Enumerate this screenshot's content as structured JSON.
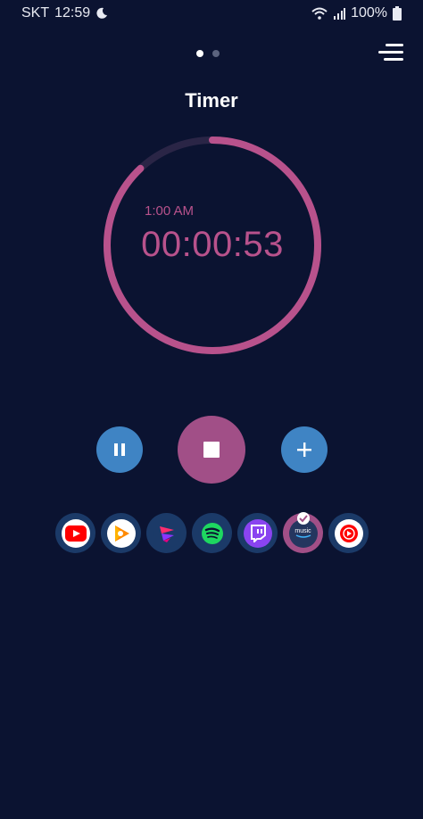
{
  "status_bar": {
    "carrier": "SKT",
    "time": "12:59",
    "battery": "100%",
    "icons": [
      "moon-icon",
      "wifi-icon",
      "signal-icon",
      "battery-icon"
    ]
  },
  "pager": {
    "pages": 2,
    "current": 1
  },
  "header": {
    "title": "Timer",
    "menu_icon": "menu-icon"
  },
  "timer": {
    "end_time": "1:00 AM",
    "remaining": "00:00:53",
    "progress_remaining": 0.88,
    "ring_color": "#b8528c",
    "track_color": "#2a2546"
  },
  "controls": {
    "pause_icon": "pause-icon",
    "stop_icon": "stop-icon",
    "add_icon": "plus-icon",
    "button_color": "#3f84c4",
    "stop_color": "#a14f87"
  },
  "apps": [
    {
      "name": "youtube",
      "icon": "youtube-icon"
    },
    {
      "name": "play-music",
      "icon": "play-music-icon"
    },
    {
      "name": "app-3",
      "icon": "music-app-icon"
    },
    {
      "name": "spotify",
      "icon": "spotify-icon"
    },
    {
      "name": "twitch",
      "icon": "twitch-icon"
    },
    {
      "name": "amazon-music",
      "icon": "amazon-music-icon",
      "label": "music",
      "selected": true
    },
    {
      "name": "youtube-music",
      "icon": "youtube-music-icon"
    }
  ]
}
